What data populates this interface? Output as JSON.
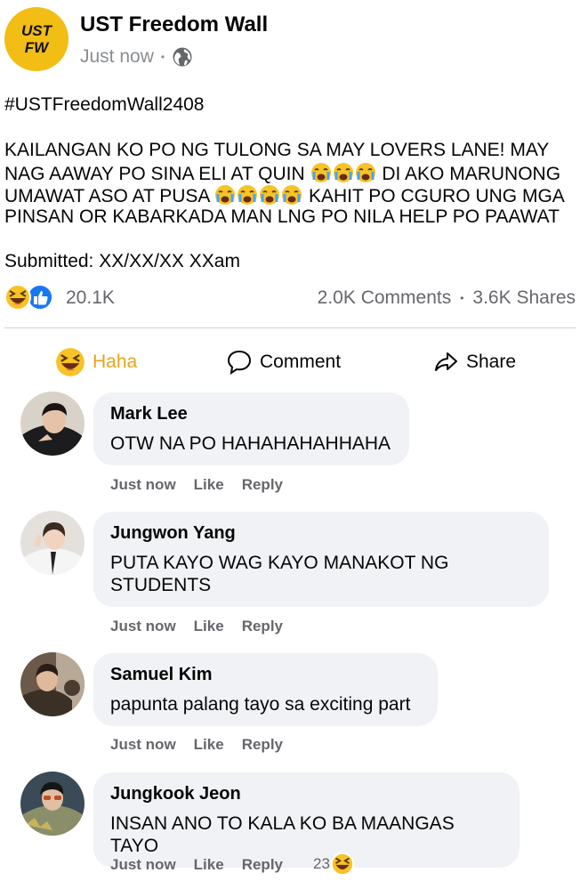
{
  "page": {
    "logo_line1": "UST",
    "logo_line2": "FW",
    "name": "UST Freedom Wall",
    "time": "Just now",
    "separator": "•",
    "privacy_icon": "globe-icon"
  },
  "post": {
    "hashtag": "#USTFreedomWall2408",
    "line1": "KAILANGAN KO PO NG TULONG SA MAY LOVERS LANE! MAY",
    "line2_a": "NAG AAWAY PO SINA ELI AT QUIN",
    "line2_b": "DI AKO MARUNONG",
    "line3_a": "UMAWAT ASO AT PUSA",
    "line3_b": "KAHIT PO CGURO UNG MGA",
    "line4": "PINSAN OR KABARKADA MAN LNG PO NILA HELP PO PAAWAT",
    "submitted": "Submitted: XX/XX/XX XXam"
  },
  "stats": {
    "reaction_icons": [
      "haha-icon",
      "like-icon"
    ],
    "reactions": "20.1K",
    "comments": "2.0K Comments",
    "separator": "•",
    "shares": "3.6K Shares"
  },
  "actions": {
    "haha": "Haha",
    "comment": "Comment",
    "share": "Share"
  },
  "comments": [
    {
      "name": "Mark Lee",
      "text": "OTW NA PO HAHAHAHAHHAHA",
      "time": "Just now",
      "like": "Like",
      "reply": "Reply"
    },
    {
      "name": "Jungwon Yang",
      "text": "PUTA KAYO WAG KAYO MANAKOT NG STUDENTS",
      "time": "Just now",
      "like": "Like",
      "reply": "Reply"
    },
    {
      "name": "Samuel Kim",
      "text": "papunta palang tayo sa exciting part",
      "time": "Just now",
      "like": "Like",
      "reply": "Reply"
    },
    {
      "name": "Jungkook Jeon",
      "text": "INSAN ANO TO KALA KO BA MAANGAS TAYO",
      "time": "Just now",
      "like": "Like",
      "reply": "Reply",
      "reaction_count": "23",
      "reaction_icon": "haha-icon"
    }
  ],
  "colors": {
    "logo": "#f2bd14",
    "haha": "#e7a31e",
    "like_blue": "#1877f2",
    "bubble": "#f0f2f5",
    "secondary_text": "#65676b"
  }
}
